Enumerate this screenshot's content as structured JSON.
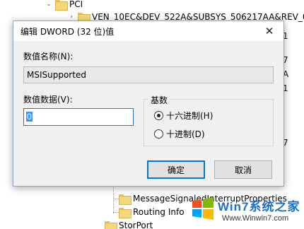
{
  "tree": {
    "items": [
      {
        "label": "PCI"
      },
      {
        "label": "VEN_10EC&DEV_522A&SUBSYS_506217AA&REV_01"
      },
      {
        "label": "MessageSignaledInterruptProperties"
      },
      {
        "label": "Routing Info"
      },
      {
        "label": "StorPort"
      }
    ],
    "right_fragments": [
      "01",
      "1",
      "7",
      "A",
      "1",
      "7",
      "7"
    ]
  },
  "dialog": {
    "title": "编辑 DWORD (32 位)值",
    "name_label": "数值名称(N):",
    "name_value": "MSISupported",
    "data_label": "数值数据(V):",
    "data_value": "0",
    "base_group": {
      "legend": "基数",
      "options": [
        {
          "label": "十六进制(H)",
          "selected": true
        },
        {
          "label": "十进制(D)",
          "selected": false
        }
      ]
    },
    "buttons": {
      "ok": "确定",
      "cancel": "取消"
    }
  },
  "watermark": {
    "brand": "Win7系统之家",
    "url": "Www.Winwin7.com"
  },
  "colors": {
    "accent": "#0078d7",
    "selection": "#3399ff",
    "folder": "#f5d77b"
  }
}
